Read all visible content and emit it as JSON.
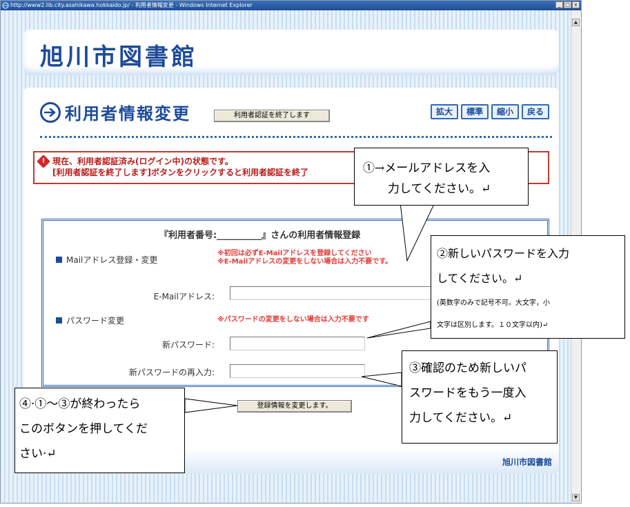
{
  "window": {
    "title": "http://www2.lib.city.asahikawa.hokkaido.jp/ - 利用者情報変更 - Windows Internet Explorer",
    "minimize_glyph": "_",
    "maximize_glyph": "□",
    "close_glyph": "x"
  },
  "site": {
    "logo": "旭川市図書館"
  },
  "page": {
    "title": "利用者情報変更"
  },
  "size_buttons": {
    "enlarge": "拡大",
    "standard": "標準",
    "shrink": "縮小",
    "back": "戻る"
  },
  "alert": {
    "line1": "現在、利用者認証済み(ログイン中)の状態です。",
    "line2": "[利用者認証を終了します]ボタンをクリックすると利用者認証を終了"
  },
  "logout_button": "利用者認証を終了します",
  "form": {
    "heading": "『利用者番号:__________』さんの利用者情報登録",
    "mail_section": "Mailアドレス登録・変更",
    "mail_note1": "※初回は必ずE-Mailアドレスを登録してください",
    "mail_note2": "※E-Mailアドレスの変更をしない場合は入力不要です。",
    "email_label": "E-Mailアドレス:",
    "email_value": "",
    "password_section": "パスワード変更",
    "password_note": "※パスワードの変更をしない場合は入力不要です",
    "new_password_label": "新パスワード:",
    "confirm_password_label": "新パスワードの再入力:"
  },
  "register_button": "登録情報を変更します。",
  "footer": {
    "library_name": "旭川市図書館"
  },
  "callouts": {
    "c1_line1": "①→メールアドレスを入",
    "c1_line2": "力してください。↵",
    "c2_line1": "②新しいパスワードを入力",
    "c2_line2": "してください。↵",
    "c2_line3": "(英数字のみで記号不可。大文字，小",
    "c2_line4": "文字は区別します。１０文字以内)↵",
    "c3_line1": "③確認のため新しいパ",
    "c3_line2": "スワードをもう一度入",
    "c3_line3": "力してください。↵",
    "c4_line1": "④·①～③が終わったら",
    "c4_line2": "このボタンを押してくだ",
    "c4_line3": "さい·↵"
  }
}
